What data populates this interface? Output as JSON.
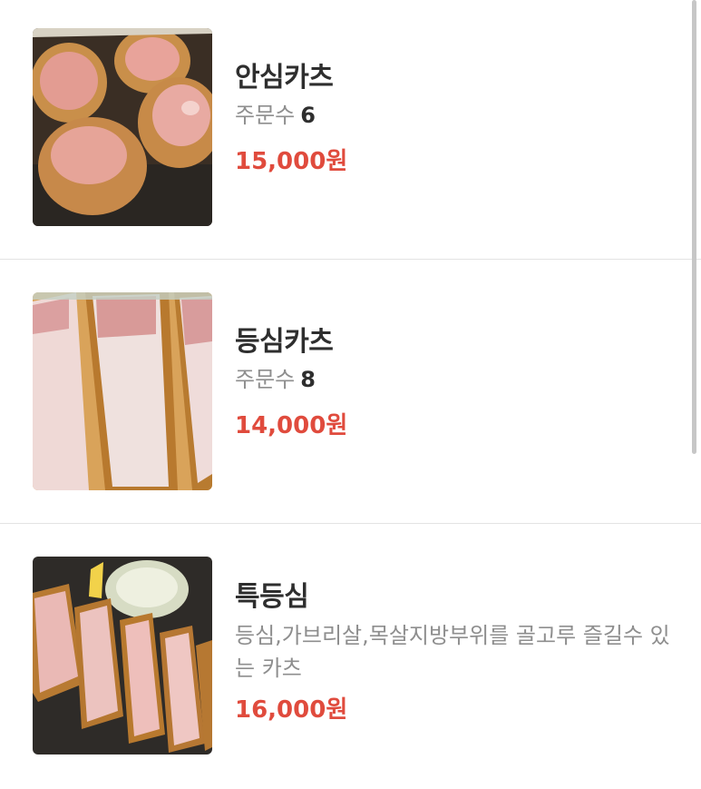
{
  "menu": {
    "items": [
      {
        "name": "안심카츠",
        "order_label": "주문수",
        "order_count": "6",
        "price": "15,000원",
        "image_icon": "food-photo-tenderloin-katsu"
      },
      {
        "name": "등심카츠",
        "order_label": "주문수",
        "order_count": "8",
        "price": "14,000원",
        "image_icon": "food-photo-loin-katsu"
      },
      {
        "name": "특등심",
        "description": "등심,가브리살,목살지방부위를 골고루 즐길수 있는 카츠",
        "price": "16,000원",
        "image_icon": "food-photo-special-loin-katsu"
      }
    ]
  },
  "colors": {
    "price": "#e04b3d",
    "title": "#2e2e2e",
    "subtext": "#8e8e8e",
    "divider": "#e3e3e3"
  }
}
